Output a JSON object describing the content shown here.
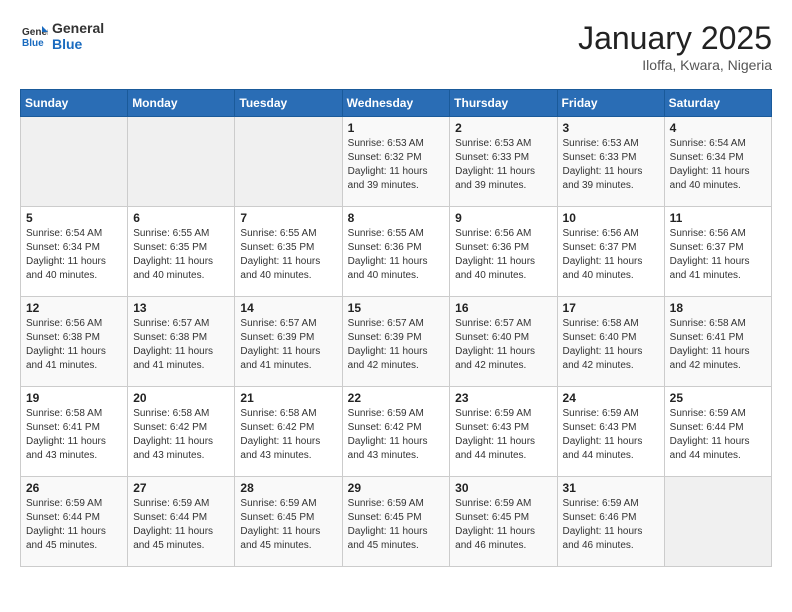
{
  "logo": {
    "line1": "General",
    "line2": "Blue"
  },
  "title": "January 2025",
  "location": "Iloffa, Kwara, Nigeria",
  "days_of_week": [
    "Sunday",
    "Monday",
    "Tuesday",
    "Wednesday",
    "Thursday",
    "Friday",
    "Saturday"
  ],
  "weeks": [
    [
      {
        "day": "",
        "info": ""
      },
      {
        "day": "",
        "info": ""
      },
      {
        "day": "",
        "info": ""
      },
      {
        "day": "1",
        "info": "Sunrise: 6:53 AM\nSunset: 6:32 PM\nDaylight: 11 hours and 39 minutes."
      },
      {
        "day": "2",
        "info": "Sunrise: 6:53 AM\nSunset: 6:33 PM\nDaylight: 11 hours and 39 minutes."
      },
      {
        "day": "3",
        "info": "Sunrise: 6:53 AM\nSunset: 6:33 PM\nDaylight: 11 hours and 39 minutes."
      },
      {
        "day": "4",
        "info": "Sunrise: 6:54 AM\nSunset: 6:34 PM\nDaylight: 11 hours and 40 minutes."
      }
    ],
    [
      {
        "day": "5",
        "info": "Sunrise: 6:54 AM\nSunset: 6:34 PM\nDaylight: 11 hours and 40 minutes."
      },
      {
        "day": "6",
        "info": "Sunrise: 6:55 AM\nSunset: 6:35 PM\nDaylight: 11 hours and 40 minutes."
      },
      {
        "day": "7",
        "info": "Sunrise: 6:55 AM\nSunset: 6:35 PM\nDaylight: 11 hours and 40 minutes."
      },
      {
        "day": "8",
        "info": "Sunrise: 6:55 AM\nSunset: 6:36 PM\nDaylight: 11 hours and 40 minutes."
      },
      {
        "day": "9",
        "info": "Sunrise: 6:56 AM\nSunset: 6:36 PM\nDaylight: 11 hours and 40 minutes."
      },
      {
        "day": "10",
        "info": "Sunrise: 6:56 AM\nSunset: 6:37 PM\nDaylight: 11 hours and 40 minutes."
      },
      {
        "day": "11",
        "info": "Sunrise: 6:56 AM\nSunset: 6:37 PM\nDaylight: 11 hours and 41 minutes."
      }
    ],
    [
      {
        "day": "12",
        "info": "Sunrise: 6:56 AM\nSunset: 6:38 PM\nDaylight: 11 hours and 41 minutes."
      },
      {
        "day": "13",
        "info": "Sunrise: 6:57 AM\nSunset: 6:38 PM\nDaylight: 11 hours and 41 minutes."
      },
      {
        "day": "14",
        "info": "Sunrise: 6:57 AM\nSunset: 6:39 PM\nDaylight: 11 hours and 41 minutes."
      },
      {
        "day": "15",
        "info": "Sunrise: 6:57 AM\nSunset: 6:39 PM\nDaylight: 11 hours and 42 minutes."
      },
      {
        "day": "16",
        "info": "Sunrise: 6:57 AM\nSunset: 6:40 PM\nDaylight: 11 hours and 42 minutes."
      },
      {
        "day": "17",
        "info": "Sunrise: 6:58 AM\nSunset: 6:40 PM\nDaylight: 11 hours and 42 minutes."
      },
      {
        "day": "18",
        "info": "Sunrise: 6:58 AM\nSunset: 6:41 PM\nDaylight: 11 hours and 42 minutes."
      }
    ],
    [
      {
        "day": "19",
        "info": "Sunrise: 6:58 AM\nSunset: 6:41 PM\nDaylight: 11 hours and 43 minutes."
      },
      {
        "day": "20",
        "info": "Sunrise: 6:58 AM\nSunset: 6:42 PM\nDaylight: 11 hours and 43 minutes."
      },
      {
        "day": "21",
        "info": "Sunrise: 6:58 AM\nSunset: 6:42 PM\nDaylight: 11 hours and 43 minutes."
      },
      {
        "day": "22",
        "info": "Sunrise: 6:59 AM\nSunset: 6:42 PM\nDaylight: 11 hours and 43 minutes."
      },
      {
        "day": "23",
        "info": "Sunrise: 6:59 AM\nSunset: 6:43 PM\nDaylight: 11 hours and 44 minutes."
      },
      {
        "day": "24",
        "info": "Sunrise: 6:59 AM\nSunset: 6:43 PM\nDaylight: 11 hours and 44 minutes."
      },
      {
        "day": "25",
        "info": "Sunrise: 6:59 AM\nSunset: 6:44 PM\nDaylight: 11 hours and 44 minutes."
      }
    ],
    [
      {
        "day": "26",
        "info": "Sunrise: 6:59 AM\nSunset: 6:44 PM\nDaylight: 11 hours and 45 minutes."
      },
      {
        "day": "27",
        "info": "Sunrise: 6:59 AM\nSunset: 6:44 PM\nDaylight: 11 hours and 45 minutes."
      },
      {
        "day": "28",
        "info": "Sunrise: 6:59 AM\nSunset: 6:45 PM\nDaylight: 11 hours and 45 minutes."
      },
      {
        "day": "29",
        "info": "Sunrise: 6:59 AM\nSunset: 6:45 PM\nDaylight: 11 hours and 45 minutes."
      },
      {
        "day": "30",
        "info": "Sunrise: 6:59 AM\nSunset: 6:45 PM\nDaylight: 11 hours and 46 minutes."
      },
      {
        "day": "31",
        "info": "Sunrise: 6:59 AM\nSunset: 6:46 PM\nDaylight: 11 hours and 46 minutes."
      },
      {
        "day": "",
        "info": ""
      }
    ]
  ]
}
